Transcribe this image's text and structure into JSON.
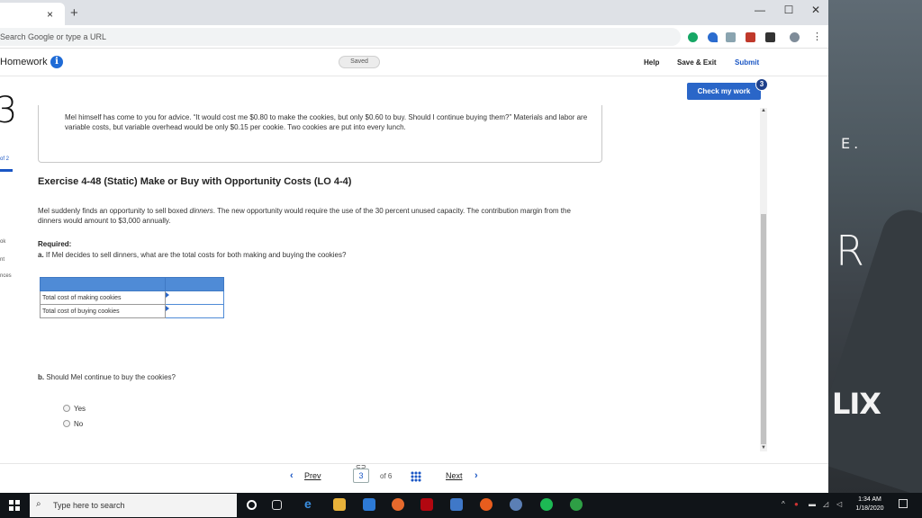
{
  "browser": {
    "omnibox_placeholder": "Search Google or type a URL",
    "tab_close": "×",
    "new_tab": "+",
    "win_minimize": "—",
    "win_maximize": "☐",
    "win_close": "✕"
  },
  "header": {
    "title": "Homework",
    "info": "i",
    "saved": "Saved",
    "help": "Help",
    "save_exit": "Save & Exit",
    "submit": "Submit"
  },
  "rail": {
    "question_number": "3",
    "part": "of 2",
    "item1": "ok",
    "item2": "nt",
    "item3": "nces"
  },
  "check_work": {
    "label": "Check my work",
    "badge": "3"
  },
  "scenario": {
    "text": "Mel himself has come to you for advice. “It would cost me $0.80 to make the cookies, but only $0.60 to buy. Should I continue buying them?” Materials and labor are variable costs, but variable overhead would be only $0.15 per cookie. Two cookies are put into every lunch."
  },
  "exercise": {
    "title": "Exercise 4-48 (Static) Make or Buy with Opportunity Costs (LO 4-4)",
    "desc_pre": "Mel suddenly finds an opportunity to sell boxed ",
    "desc_italic": "dinners",
    "desc_post": ". The new opportunity would require the use of the 30 percent unused capacity. The contribution margin from the dinners would amount to $3,000 annually.",
    "required": "Required:",
    "qa_label": "a.",
    "qa_text": " If Mel decides to sell dinners, what are the total costs for both making and buying the cookies?",
    "table_rows": [
      {
        "label": "Total cost of making cookies",
        "value": ""
      },
      {
        "label": "Total cost of buying cookies",
        "value": ""
      }
    ],
    "qb_label": "b.",
    "qb_text": " Should Mel continue to buy the cookies?",
    "options": [
      "Yes",
      "No"
    ]
  },
  "pager": {
    "prev": "Prev",
    "current": "3",
    "of": "of 6",
    "next": "Next"
  },
  "taskbar": {
    "search_placeholder": "Type here to search",
    "time": "1:34 AM",
    "date": "1/18/2020"
  },
  "desktop": {
    "e": "E.",
    "r": "R",
    "lix": "LIX"
  },
  "colors": {
    "accent": "#2a66c8",
    "table_header": "#4f8bd6",
    "taskbar": "#101418"
  }
}
